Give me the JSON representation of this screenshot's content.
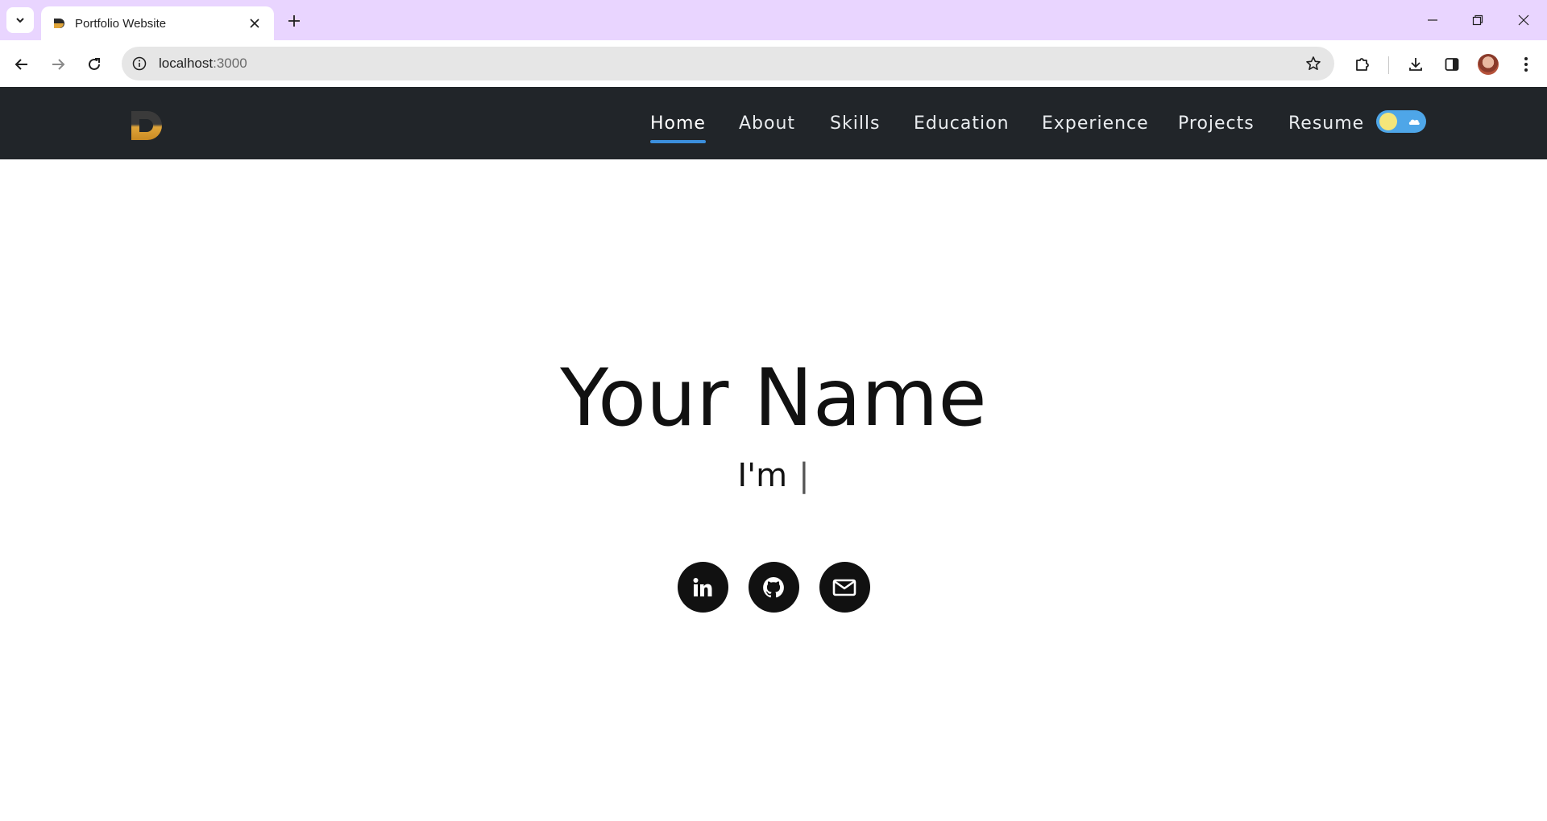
{
  "browser": {
    "tab": {
      "title": "Portfolio Website"
    },
    "address": {
      "host": "localhost",
      "port": ":3000"
    }
  },
  "site": {
    "nav_links": [
      {
        "label": "Home",
        "active": true
      },
      {
        "label": "About"
      },
      {
        "label": "Skills"
      },
      {
        "label": "Education"
      },
      {
        "label": "Experience"
      },
      {
        "label": "Projects"
      },
      {
        "label": "Resume"
      }
    ],
    "theme_toggle": {
      "mode": "light"
    }
  },
  "hero": {
    "name": "Your Name",
    "subtitle_prefix": "I'm",
    "cursor": "|",
    "socials": [
      {
        "icon": "linkedin-icon"
      },
      {
        "icon": "github-icon"
      },
      {
        "icon": "email-icon"
      }
    ]
  },
  "colors": {
    "tabstrip": "#e9d5ff",
    "navbar": "#212529",
    "active_underline": "#3b8fdd",
    "social_bg": "#111111",
    "toggle_track": "#4ea6e8",
    "toggle_knob": "#f5e67a"
  }
}
